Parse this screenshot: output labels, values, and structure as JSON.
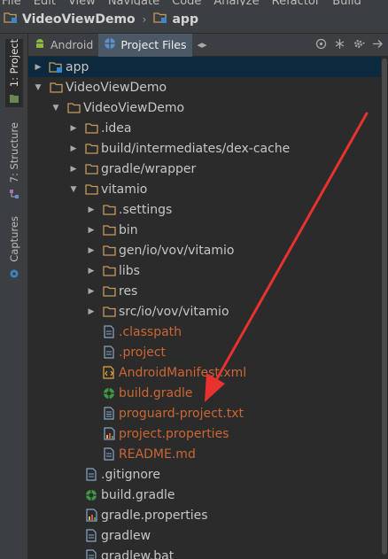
{
  "menu": [
    "File",
    "Edit",
    "View",
    "Navigate",
    "Code",
    "Analyze",
    "Refactor",
    "Build"
  ],
  "breadcrumb": [
    {
      "label": "VideoViewDemo"
    },
    {
      "label": "app"
    }
  ],
  "side_tabs": [
    {
      "label": "1: Project",
      "active": true
    },
    {
      "label": "7: Structure",
      "active": false
    },
    {
      "label": "Captures",
      "active": false
    }
  ],
  "panel_tabs": [
    {
      "label": "Android",
      "active": false
    },
    {
      "label": "Project Files",
      "active": true
    }
  ],
  "tree": [
    {
      "label": "app",
      "depth": 0,
      "arrow": "collapsed",
      "icon": "module-folder-icon",
      "color": "light",
      "selected": true
    },
    {
      "label": "VideoViewDemo",
      "depth": 0,
      "arrow": "expanded",
      "icon": "folder-icon",
      "color": "light"
    },
    {
      "label": "VideoViewDemo",
      "depth": 1,
      "arrow": "expanded",
      "icon": "folder-icon",
      "color": "light"
    },
    {
      "label": ".idea",
      "depth": 2,
      "arrow": "collapsed",
      "icon": "folder-icon",
      "color": "light"
    },
    {
      "label": "build/intermediates/dex-cache",
      "depth": 2,
      "arrow": "collapsed",
      "icon": "folder-icon",
      "color": "light"
    },
    {
      "label": "gradle/wrapper",
      "depth": 2,
      "arrow": "collapsed",
      "icon": "folder-icon",
      "color": "light"
    },
    {
      "label": "vitamio",
      "depth": 2,
      "arrow": "expanded",
      "icon": "folder-icon",
      "color": "light"
    },
    {
      "label": ".settings",
      "depth": 3,
      "arrow": "collapsed",
      "icon": "folder-icon",
      "color": "light"
    },
    {
      "label": "bin",
      "depth": 3,
      "arrow": "collapsed",
      "icon": "folder-icon",
      "color": "light"
    },
    {
      "label": "gen/io/vov/vitamio",
      "depth": 3,
      "arrow": "collapsed",
      "icon": "folder-icon",
      "color": "light"
    },
    {
      "label": "libs",
      "depth": 3,
      "arrow": "collapsed",
      "icon": "folder-icon",
      "color": "light"
    },
    {
      "label": "res",
      "depth": 3,
      "arrow": "collapsed",
      "icon": "folder-icon",
      "color": "light"
    },
    {
      "label": "src/io/vov/vitamio",
      "depth": 3,
      "arrow": "collapsed",
      "icon": "folder-icon",
      "color": "light"
    },
    {
      "label": ".classpath",
      "depth": 3,
      "arrow": "none",
      "icon": "file-icon",
      "color": "orange"
    },
    {
      "label": ".project",
      "depth": 3,
      "arrow": "none",
      "icon": "file-icon",
      "color": "orange"
    },
    {
      "label": "AndroidManifest.xml",
      "depth": 3,
      "arrow": "none",
      "icon": "xml-file-icon",
      "color": "orange"
    },
    {
      "label": "build.gradle",
      "depth": 3,
      "arrow": "none",
      "icon": "gradle-file-icon",
      "color": "orange"
    },
    {
      "label": "proguard-project.txt",
      "depth": 3,
      "arrow": "none",
      "icon": "text-file-icon",
      "color": "orange"
    },
    {
      "label": "project.properties",
      "depth": 3,
      "arrow": "none",
      "icon": "properties-file-icon",
      "color": "orange"
    },
    {
      "label": "README.md",
      "depth": 3,
      "arrow": "none",
      "icon": "file-icon",
      "color": "orange"
    },
    {
      "label": ".gitignore",
      "depth": 2,
      "arrow": "none",
      "icon": "file-icon",
      "color": "light"
    },
    {
      "label": "build.gradle",
      "depth": 2,
      "arrow": "none",
      "icon": "gradle-file-icon",
      "color": "light"
    },
    {
      "label": "gradle.properties",
      "depth": 2,
      "arrow": "none",
      "icon": "properties-file-icon",
      "color": "light"
    },
    {
      "label": "gradlew",
      "depth": 2,
      "arrow": "none",
      "icon": "file-icon",
      "color": "light"
    },
    {
      "label": "gradlew.bat",
      "depth": 2,
      "arrow": "none",
      "icon": "file-icon",
      "color": "light"
    }
  ],
  "colors": {
    "background": "#2b2b2b",
    "chrome": "#3c3f41",
    "selection": "#0d293e",
    "vcs_unversioned": "#cc6633",
    "annotation_arrow": "#e8322f"
  }
}
